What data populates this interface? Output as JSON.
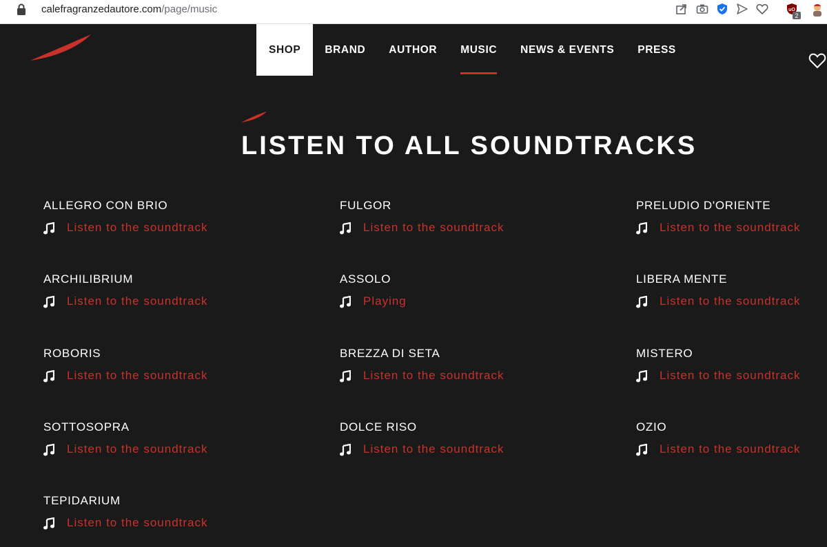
{
  "browser": {
    "url_host": "calefragranzedautore.com",
    "url_path": "/page/music",
    "extension_badge": "2",
    "icons": [
      "lock-icon",
      "share-icon",
      "camera-icon",
      "shield-check-icon",
      "send-icon",
      "heart-outline-icon",
      "ublock-icon",
      "extension-avatar-icon"
    ]
  },
  "header": {
    "nav": [
      {
        "label": "SHOP"
      },
      {
        "label": "BRAND"
      },
      {
        "label": "AUTHOR"
      },
      {
        "label": "MUSIC"
      },
      {
        "label": "NEWS & EVENTS"
      },
      {
        "label": "PRESS"
      }
    ],
    "active_nav": "MUSIC",
    "icons": [
      "brand-logo-icon",
      "heart-icon"
    ]
  },
  "page": {
    "title": "LISTEN TO ALL SOUNDTRACKS"
  },
  "tracks": [
    {
      "name": "ALLEGRO CON BRIO",
      "link": "Listen to the soundtrack"
    },
    {
      "name": "FULGOR",
      "link": "Listen to the soundtrack"
    },
    {
      "name": "PRELUDIO D'ORIENTE",
      "link": "Listen to the soundtrack"
    },
    {
      "name": "ARCHILIBRIUM",
      "link": "Listen to the soundtrack"
    },
    {
      "name": "ASSOLO",
      "link": "Playing"
    },
    {
      "name": "LIBERA MENTE",
      "link": "Listen to the soundtrack"
    },
    {
      "name": "ROBORIS",
      "link": "Listen to the soundtrack"
    },
    {
      "name": "BREZZA DI SETA",
      "link": "Listen to the soundtrack"
    },
    {
      "name": "MISTERO",
      "link": "Listen to the soundtrack"
    },
    {
      "name": "SOTTOSOPRA",
      "link": "Listen to the soundtrack"
    },
    {
      "name": "DOLCE RISO",
      "link": "Listen to the soundtrack"
    },
    {
      "name": "OZIO",
      "link": "Listen to the soundtrack"
    },
    {
      "name": "TEPIDARIUM",
      "link": "Listen to the soundtrack"
    }
  ],
  "colors": {
    "background": "#1b1a1b",
    "accent": "#c8322a",
    "text": "#ffffff"
  }
}
